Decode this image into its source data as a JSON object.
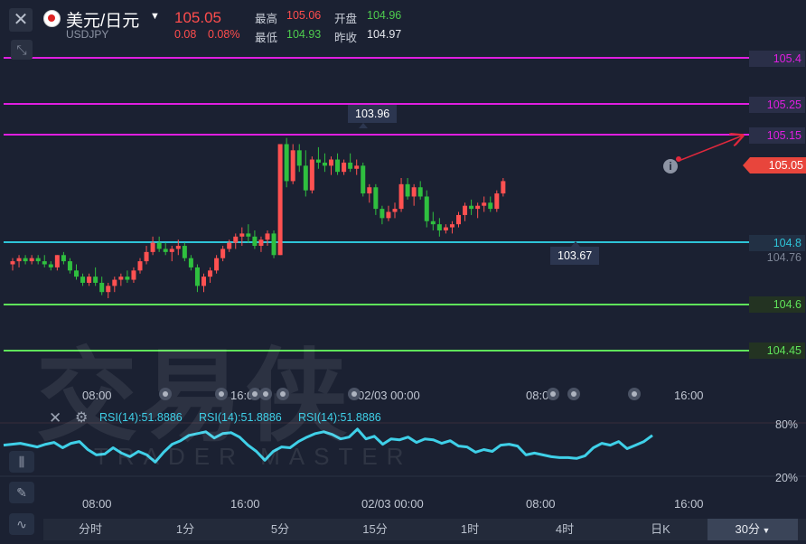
{
  "header": {
    "pair_name": "美元/日元",
    "pair_code": "USDJPY",
    "last_price": "105.05",
    "change": "0.08",
    "change_pct": "0.08%",
    "high_label": "最高",
    "high_value": "105.06",
    "low_label": "最低",
    "low_value": "104.93",
    "open_label": "开盘",
    "open_value": "104.96",
    "prev_close_label": "昨收",
    "prev_close_value": "104.97"
  },
  "price_levels": [
    {
      "label": "105.4",
      "color": "#e01ee0"
    },
    {
      "label": "105.25",
      "color": "#e01ee0"
    },
    {
      "label": "105.15",
      "color": "#e01ee0"
    },
    {
      "label": "104.8",
      "color": "#2ec4d8"
    },
    {
      "label": "104.6",
      "color": "#5fe35a"
    },
    {
      "label": "104.45",
      "color": "#5fe35a"
    }
  ],
  "current_price_tag": "105.05",
  "secondary_price_tag": "104.76",
  "hud": {
    "max_label": "103.96",
    "min_label": "103.67"
  },
  "time_axis": [
    "08:00",
    "16:00",
    "02/03 00:00",
    "08:00",
    "16:00"
  ],
  "rsi": {
    "labels": [
      "RSI(14):51.8886",
      "RSI(14):51.8886",
      "RSI(14):51.8886"
    ],
    "upper_level": "80%",
    "lower_level": "20%"
  },
  "watermark": {
    "cn": "交易侠",
    "en": "TRADER MASTER"
  },
  "timeframes": [
    "分时",
    "1分",
    "5分",
    "15分",
    "1时",
    "4时",
    "日K",
    "30分"
  ],
  "active_timeframe": "30分",
  "colors": {
    "up": "#ff5151",
    "down": "#2fbf3f",
    "rsi": "#3fd0e8",
    "background": "#1b2132"
  },
  "chart_data": {
    "type": "candlestick",
    "price_range": [
      104.4,
      105.5
    ],
    "candles": [
      [
        104.73,
        104.75,
        104.71,
        104.74
      ],
      [
        104.74,
        104.76,
        104.72,
        104.75
      ],
      [
        104.75,
        104.76,
        104.73,
        104.74
      ],
      [
        104.74,
        104.76,
        104.73,
        104.75
      ],
      [
        104.75,
        104.76,
        104.73,
        104.74
      ],
      [
        104.74,
        104.76,
        104.72,
        104.73
      ],
      [
        104.73,
        104.74,
        104.71,
        104.72
      ],
      [
        104.72,
        104.76,
        104.71,
        104.76
      ],
      [
        104.76,
        104.77,
        104.73,
        104.74
      ],
      [
        104.74,
        104.75,
        104.7,
        104.71
      ],
      [
        104.71,
        104.73,
        104.68,
        104.69
      ],
      [
        104.69,
        104.7,
        104.66,
        104.67
      ],
      [
        104.67,
        104.7,
        104.66,
        104.69
      ],
      [
        104.69,
        104.72,
        104.66,
        104.67
      ],
      [
        104.67,
        104.69,
        104.63,
        104.64
      ],
      [
        104.64,
        104.67,
        104.62,
        104.66
      ],
      [
        104.66,
        104.69,
        104.64,
        104.68
      ],
      [
        104.68,
        104.7,
        104.66,
        104.69
      ],
      [
        104.69,
        104.71,
        104.67,
        104.68
      ],
      [
        104.68,
        104.72,
        104.67,
        104.71
      ],
      [
        104.71,
        104.75,
        104.7,
        104.74
      ],
      [
        104.74,
        104.79,
        104.73,
        104.77
      ],
      [
        104.77,
        104.82,
        104.76,
        104.8
      ],
      [
        104.8,
        104.82,
        104.77,
        104.78
      ],
      [
        104.78,
        104.8,
        104.76,
        104.77
      ],
      [
        104.77,
        104.79,
        104.74,
        104.78
      ],
      [
        104.78,
        104.81,
        104.76,
        104.79
      ],
      [
        104.79,
        104.8,
        104.74,
        104.75
      ],
      [
        104.75,
        104.76,
        104.71,
        104.72
      ],
      [
        104.72,
        104.73,
        104.64,
        104.66
      ],
      [
        104.66,
        104.7,
        104.64,
        104.69
      ],
      [
        104.69,
        104.72,
        104.67,
        104.71
      ],
      [
        104.71,
        104.76,
        104.7,
        104.75
      ],
      [
        104.75,
        104.79,
        104.74,
        104.78
      ],
      [
        104.78,
        104.81,
        104.77,
        104.8
      ],
      [
        104.8,
        104.83,
        104.78,
        104.82
      ],
      [
        104.82,
        104.85,
        104.79,
        104.83
      ],
      [
        104.83,
        104.86,
        104.8,
        104.82
      ],
      [
        104.82,
        104.84,
        104.78,
        104.79
      ],
      [
        104.79,
        104.82,
        104.77,
        104.81
      ],
      [
        104.81,
        104.84,
        104.79,
        104.83
      ],
      [
        104.83,
        104.84,
        104.75,
        104.76
      ],
      [
        104.76,
        105.12,
        104.76,
        105.12
      ],
      [
        105.12,
        105.14,
        104.98,
        105.0
      ],
      [
        105.0,
        105.12,
        104.99,
        105.1
      ],
      [
        105.1,
        105.12,
        105.03,
        105.05
      ],
      [
        105.05,
        105.1,
        104.95,
        104.97
      ],
      [
        104.97,
        105.08,
        104.96,
        105.07
      ],
      [
        105.07,
        105.11,
        105.04,
        105.06
      ],
      [
        105.06,
        105.09,
        105.03,
        105.05
      ],
      [
        105.05,
        105.08,
        105.02,
        105.07
      ],
      [
        105.07,
        105.09,
        105.02,
        105.03
      ],
      [
        105.03,
        105.07,
        105.02,
        105.06
      ],
      [
        105.06,
        105.09,
        105.03,
        105.04
      ],
      [
        105.04,
        105.07,
        105.02,
        105.05
      ],
      [
        105.05,
        105.06,
        104.95,
        104.96
      ],
      [
        104.96,
        104.99,
        104.93,
        104.98
      ],
      [
        104.98,
        104.99,
        104.89,
        104.91
      ],
      [
        104.91,
        104.92,
        104.86,
        104.88
      ],
      [
        104.88,
        104.92,
        104.87,
        104.9
      ],
      [
        104.9,
        104.93,
        104.88,
        104.91
      ],
      [
        104.91,
        105.01,
        104.9,
        104.99
      ],
      [
        104.99,
        105.01,
        104.94,
        104.95
      ],
      [
        104.95,
        104.99,
        104.92,
        104.98
      ],
      [
        104.98,
        105.0,
        104.94,
        104.95
      ],
      [
        104.95,
        104.97,
        104.85,
        104.87
      ],
      [
        104.87,
        104.9,
        104.84,
        104.86
      ],
      [
        104.86,
        104.88,
        104.82,
        104.84
      ],
      [
        104.84,
        104.86,
        104.83,
        104.85
      ],
      [
        104.85,
        104.87,
        104.83,
        104.86
      ],
      [
        104.86,
        104.9,
        104.85,
        104.89
      ],
      [
        104.89,
        104.93,
        104.87,
        104.92
      ],
      [
        104.92,
        104.94,
        104.89,
        104.91
      ],
      [
        104.91,
        104.93,
        104.88,
        104.92
      ],
      [
        104.92,
        104.95,
        104.9,
        104.93
      ],
      [
        104.93,
        104.95,
        104.9,
        104.91
      ],
      [
        104.91,
        104.97,
        104.9,
        104.96
      ],
      [
        104.96,
        105.01,
        104.95,
        105.0
      ]
    ],
    "rsi_values": [
      55,
      56,
      57,
      55,
      53,
      56,
      58,
      52,
      57,
      59,
      50,
      44,
      45,
      52,
      46,
      42,
      48,
      44,
      36,
      47,
      56,
      60,
      66,
      68,
      70,
      63,
      68,
      69,
      64,
      55,
      48,
      38,
      48,
      53,
      52,
      59,
      64,
      68,
      70,
      67,
      62,
      64,
      73,
      62,
      65,
      56,
      62,
      61,
      64,
      58,
      62,
      61,
      57,
      60,
      54,
      53,
      47,
      50,
      48,
      55,
      56,
      54,
      44,
      46,
      44,
      42,
      41,
      41,
      40,
      43,
      52,
      57,
      55,
      59,
      51,
      55,
      59,
      66
    ]
  }
}
